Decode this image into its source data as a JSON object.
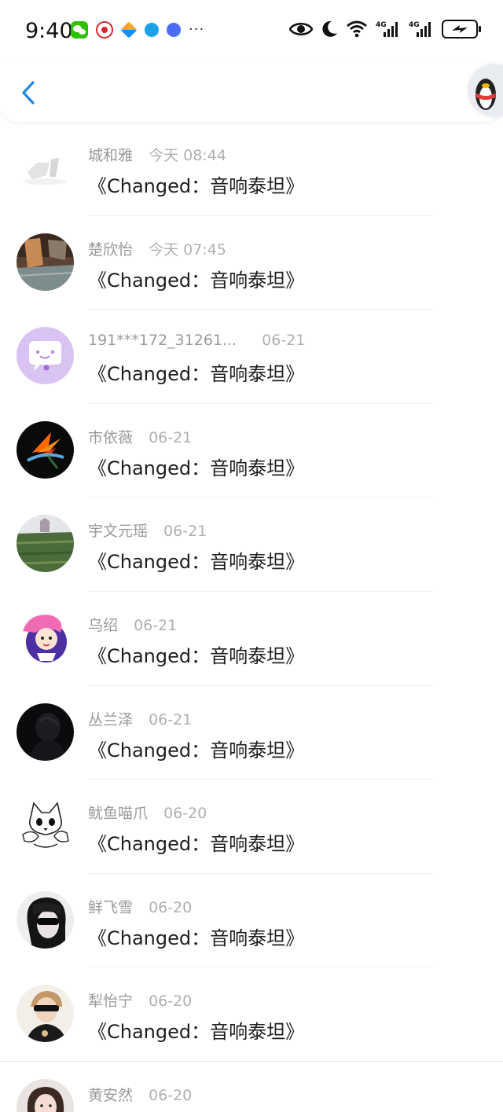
{
  "status_bar": {
    "time": "9:40",
    "notification_icons": [
      "wechat-icon",
      "shopping-618-icon",
      "navigation-icon",
      "browser-icon",
      "music-icon"
    ],
    "more": "···",
    "system_icons": [
      "eye-icon",
      "moon-icon",
      "wifi-icon",
      "signal-4g-icon",
      "signal-4g-icon",
      "battery-charging-icon"
    ]
  },
  "header": {
    "back_icon": "chevron-left-icon",
    "accent_color": "#1e88e5"
  },
  "list": {
    "items": [
      {
        "name": "城和雅",
        "date": "今天 08:44",
        "content": "《Changed：音响泰坦》",
        "avatar": "blank-grey"
      },
      {
        "name": "楚欣怡",
        "date": "今天 07:45",
        "content": "《Changed：音响泰坦》",
        "avatar": "room-photo"
      },
      {
        "name": "191***172_31261...",
        "date": "06-21",
        "content": "《Changed：音响泰坦》",
        "avatar": "purple-chat-bubble"
      },
      {
        "name": "市依薇",
        "date": "06-21",
        "content": "《Changed：音响泰坦》",
        "avatar": "bird-of-paradise-flower"
      },
      {
        "name": "宇文元瑶",
        "date": "06-21",
        "content": "《Changed：音响泰坦》",
        "avatar": "green-field"
      },
      {
        "name": "乌绍",
        "date": "06-21",
        "content": "《Changed：音响泰坦》",
        "avatar": "cartoon-girl"
      },
      {
        "name": "丛兰泽",
        "date": "06-21",
        "content": "《Changed：音响泰坦》",
        "avatar": "dark-portrait"
      },
      {
        "name": "鱿鱼喵爪",
        "date": "06-20",
        "content": "《Changed：音响泰坦》",
        "avatar": "cartoon-cat"
      },
      {
        "name": "鲜飞雪",
        "date": "06-20",
        "content": "《Changed：音响泰坦》",
        "avatar": "sunglasses-girl"
      },
      {
        "name": "犁怡宁",
        "date": "06-20",
        "content": "《Changed：音响泰坦》",
        "avatar": "sunglasses-boy"
      },
      {
        "name": "黄安然",
        "date": "06-20",
        "content": "",
        "avatar": "girl-portrait"
      }
    ]
  }
}
